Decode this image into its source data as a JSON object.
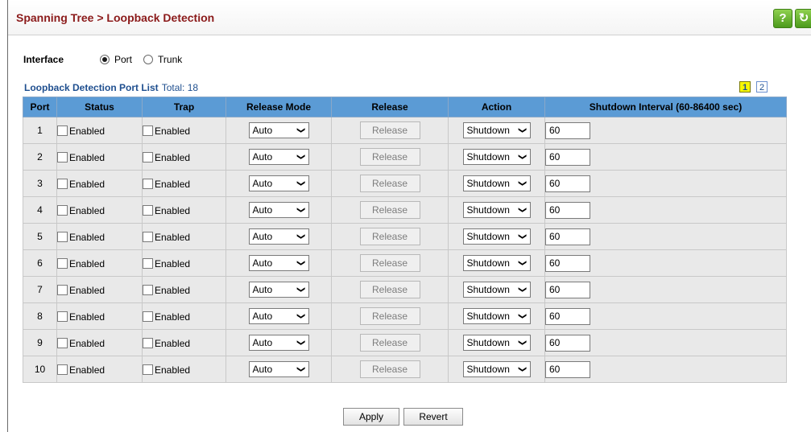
{
  "title": "Spanning Tree > Loopback Detection",
  "toolbar": {
    "help_icon_text": "?",
    "refresh_icon_text": "↻"
  },
  "interface": {
    "label": "Interface",
    "options": [
      {
        "label": "Port",
        "selected": true
      },
      {
        "label": "Trunk",
        "selected": false
      }
    ]
  },
  "list": {
    "title": "Loopback Detection Port List",
    "total": "Total: 18",
    "pages": [
      "1",
      "2"
    ],
    "current_page": "1"
  },
  "columns": [
    "Port",
    "Status",
    "Trap",
    "Release Mode",
    "Release",
    "Action",
    "Shutdown Interval (60-86400 sec)"
  ],
  "rows": [
    {
      "port": "1",
      "status": "Enabled",
      "trap": "Enabled",
      "release_mode": "Auto",
      "release": "Release",
      "action": "Shutdown",
      "interval": "60"
    },
    {
      "port": "2",
      "status": "Enabled",
      "trap": "Enabled",
      "release_mode": "Auto",
      "release": "Release",
      "action": "Shutdown",
      "interval": "60"
    },
    {
      "port": "3",
      "status": "Enabled",
      "trap": "Enabled",
      "release_mode": "Auto",
      "release": "Release",
      "action": "Shutdown",
      "interval": "60"
    },
    {
      "port": "4",
      "status": "Enabled",
      "trap": "Enabled",
      "release_mode": "Auto",
      "release": "Release",
      "action": "Shutdown",
      "interval": "60"
    },
    {
      "port": "5",
      "status": "Enabled",
      "trap": "Enabled",
      "release_mode": "Auto",
      "release": "Release",
      "action": "Shutdown",
      "interval": "60"
    },
    {
      "port": "6",
      "status": "Enabled",
      "trap": "Enabled",
      "release_mode": "Auto",
      "release": "Release",
      "action": "Shutdown",
      "interval": "60"
    },
    {
      "port": "7",
      "status": "Enabled",
      "trap": "Enabled",
      "release_mode": "Auto",
      "release": "Release",
      "action": "Shutdown",
      "interval": "60"
    },
    {
      "port": "8",
      "status": "Enabled",
      "trap": "Enabled",
      "release_mode": "Auto",
      "release": "Release",
      "action": "Shutdown",
      "interval": "60"
    },
    {
      "port": "9",
      "status": "Enabled",
      "trap": "Enabled",
      "release_mode": "Auto",
      "release": "Release",
      "action": "Shutdown",
      "interval": "60"
    },
    {
      "port": "10",
      "status": "Enabled",
      "trap": "Enabled",
      "release_mode": "Auto",
      "release": "Release",
      "action": "Shutdown",
      "interval": "60"
    }
  ],
  "buttons": {
    "apply": "Apply",
    "revert": "Revert"
  }
}
